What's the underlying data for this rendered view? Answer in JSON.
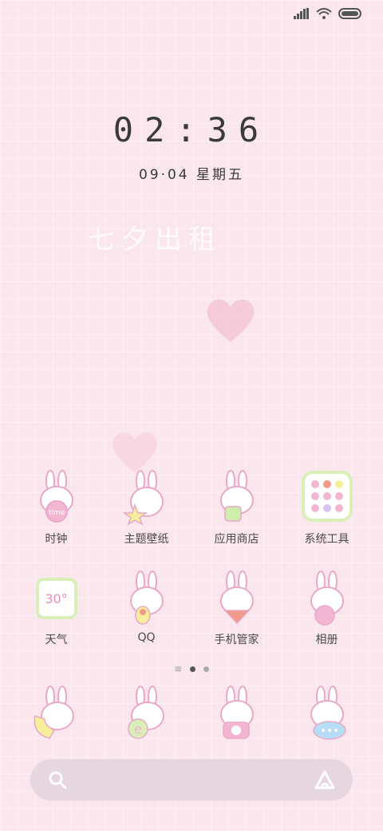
{
  "clock": {
    "time": "02:36"
  },
  "date": {
    "text": "09·04 星期五"
  },
  "watermark": {
    "text": "七夕出租"
  },
  "apps_row1": [
    {
      "label": "时钟",
      "icon": "clock-bunny-icon"
    },
    {
      "label": "主题壁纸",
      "icon": "theme-bunny-icon"
    },
    {
      "label": "应用商店",
      "icon": "store-bunny-icon"
    },
    {
      "label": "系统工具",
      "icon": "folder-icon"
    }
  ],
  "apps_row2": [
    {
      "label": "天气",
      "icon": "weather-icon",
      "badge": "30°"
    },
    {
      "label": "QQ",
      "icon": "qq-bunny-icon"
    },
    {
      "label": "手机管家",
      "icon": "security-bunny-icon"
    },
    {
      "label": "相册",
      "icon": "gallery-bunny-icon"
    }
  ],
  "dock": [
    {
      "icon": "phone-bunny-icon"
    },
    {
      "icon": "browser-bunny-icon"
    },
    {
      "icon": "camera-bunny-icon"
    },
    {
      "icon": "messages-bunny-icon"
    }
  ],
  "colors": {
    "bg": "#fbe6ee",
    "bunny_outline": "#e9a8c8",
    "text": "#4a4a4a"
  }
}
